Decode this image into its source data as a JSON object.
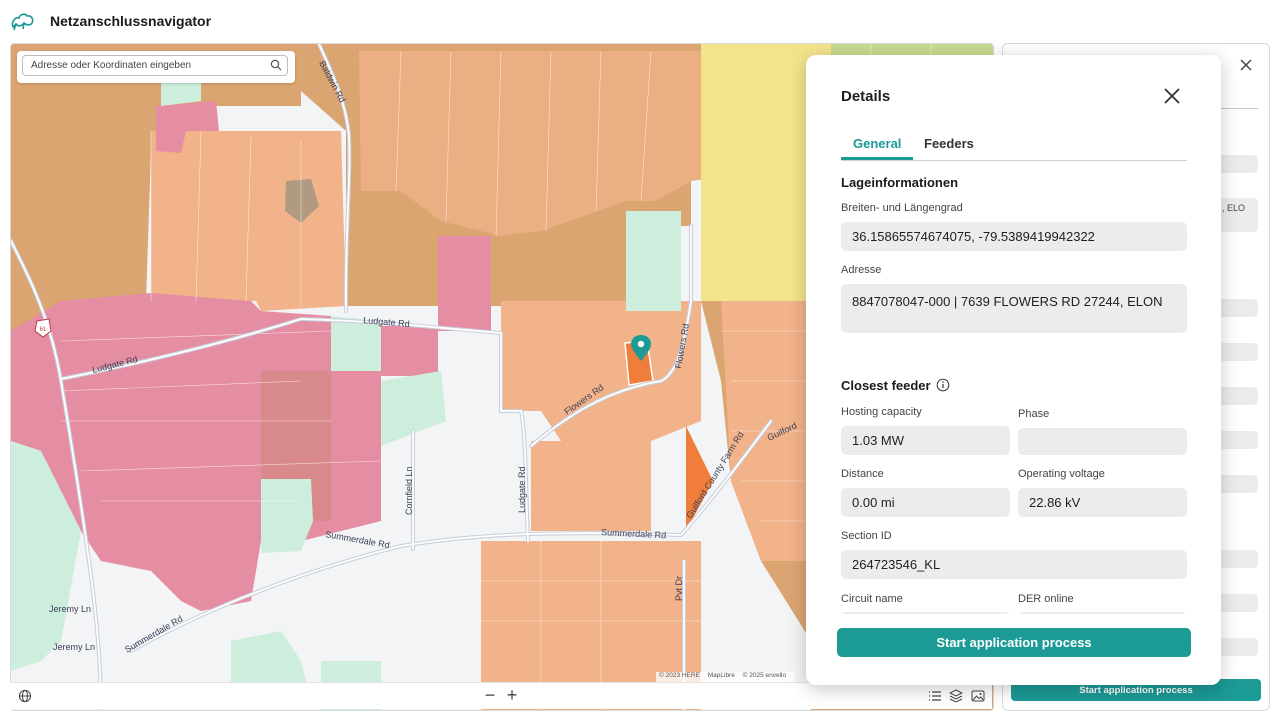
{
  "app": {
    "title": "Netzanschlussnavigator"
  },
  "search": {
    "placeholder": "Adresse oder Koordinaten eingeben"
  },
  "map": {
    "street_labels": [
      "Baldwin Rd",
      "Ludgate Rd",
      "Ludgate Rd",
      "Flowers Rd",
      "Flowers Rd",
      "Ludgate Rd",
      "Cornfield Ln",
      "Summerdale Rd",
      "Summerdale Rd",
      "Summerdale Rd",
      "Guilford County Farm Rd",
      "Guilford",
      "Jeremy Ln",
      "Jeremy Ln",
      "Pvt Dr"
    ],
    "route_shield": "61",
    "attribution": [
      "© 2023 HERE",
      "MapLibre",
      "© 2025 envello"
    ],
    "colors": {
      "orange": "#f2b28a",
      "brown": "#dba572",
      "pink": "#e58da3",
      "mint": "#cdeedd",
      "yellow": "#f3e48b",
      "green": "#c8dc8f",
      "teal_accent": "#1c9a96"
    }
  },
  "toolbar": {
    "globe_icon": "globe-icon",
    "zoom_out_label": "−",
    "zoom_in_label": "+",
    "list_icon": "list-icon",
    "layers_icon": "layers-icon",
    "image_icon": "image-icon"
  },
  "background_panel": {
    "fragment_text": ", ELO",
    "button_label": "Start application process"
  },
  "details": {
    "title": "Details",
    "tabs": [
      {
        "label": "General",
        "active": true
      },
      {
        "label": "Feeders",
        "active": false
      }
    ],
    "location": {
      "section_title": "Lageinformationen",
      "coords_label": "Breiten- und Längengrad",
      "coords_value": "36.15865574674075, -79.5389419942322",
      "address_label": "Adresse",
      "address_value": "8847078047-000 | 7639 FLOWERS RD 27244, ELON"
    },
    "feeder": {
      "section_title": "Closest feeder",
      "hosting_capacity_label": "Hosting capacity",
      "hosting_capacity_value": "1.03 MW",
      "phase_label": "Phase",
      "phase_value": "",
      "distance_label": "Distance",
      "distance_value": "0.00 mi",
      "operating_voltage_label": "Operating voltage",
      "operating_voltage_value": "22.86 kV",
      "section_id_label": "Section ID",
      "section_id_value": "264723546_KL",
      "circuit_name_label": "Circuit name",
      "der_online_label": "DER online"
    },
    "cta_label": "Start application process"
  }
}
